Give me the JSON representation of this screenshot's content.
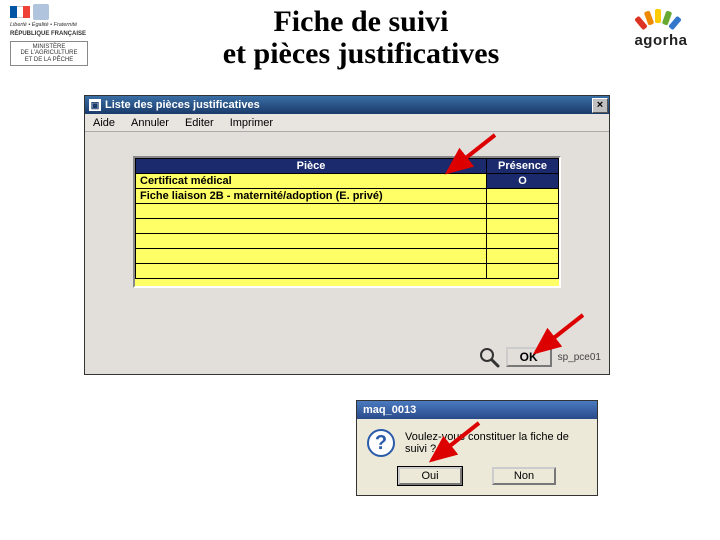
{
  "header": {
    "motto": "Liberté • Égalité • Fraternité",
    "republic": "RÉPUBLIQUE FRANÇAISE",
    "ministry_line1": "MINISTÈRE",
    "ministry_line2": "DE L'AGRICULTURE",
    "ministry_line3": "ET DE LA PÊCHE",
    "title_line1": "Fiche de suivi",
    "title_line2": "et pièces justificatives",
    "brand": "agorha"
  },
  "window": {
    "title": "Liste des pièces justificatives",
    "menu": {
      "aide": "Aide",
      "annuler": "Annuler",
      "editer": "Editer",
      "imprimer": "Imprimer"
    },
    "table": {
      "col_piece": "Pièce",
      "col_presence": "Présence",
      "rows": [
        {
          "piece": "Certificat médical",
          "presence": "O",
          "selected": true
        },
        {
          "piece": "Fiche liaison 2B - maternité/adoption (E. privé)",
          "presence": "",
          "selected": false
        }
      ]
    },
    "ok_label": "OK",
    "sp_label": "sp_pce01"
  },
  "dialog": {
    "title": "maq_0013",
    "text": "Voulez-vous constituer la fiche de suivi ?",
    "yes": "Oui",
    "no": "Non"
  }
}
